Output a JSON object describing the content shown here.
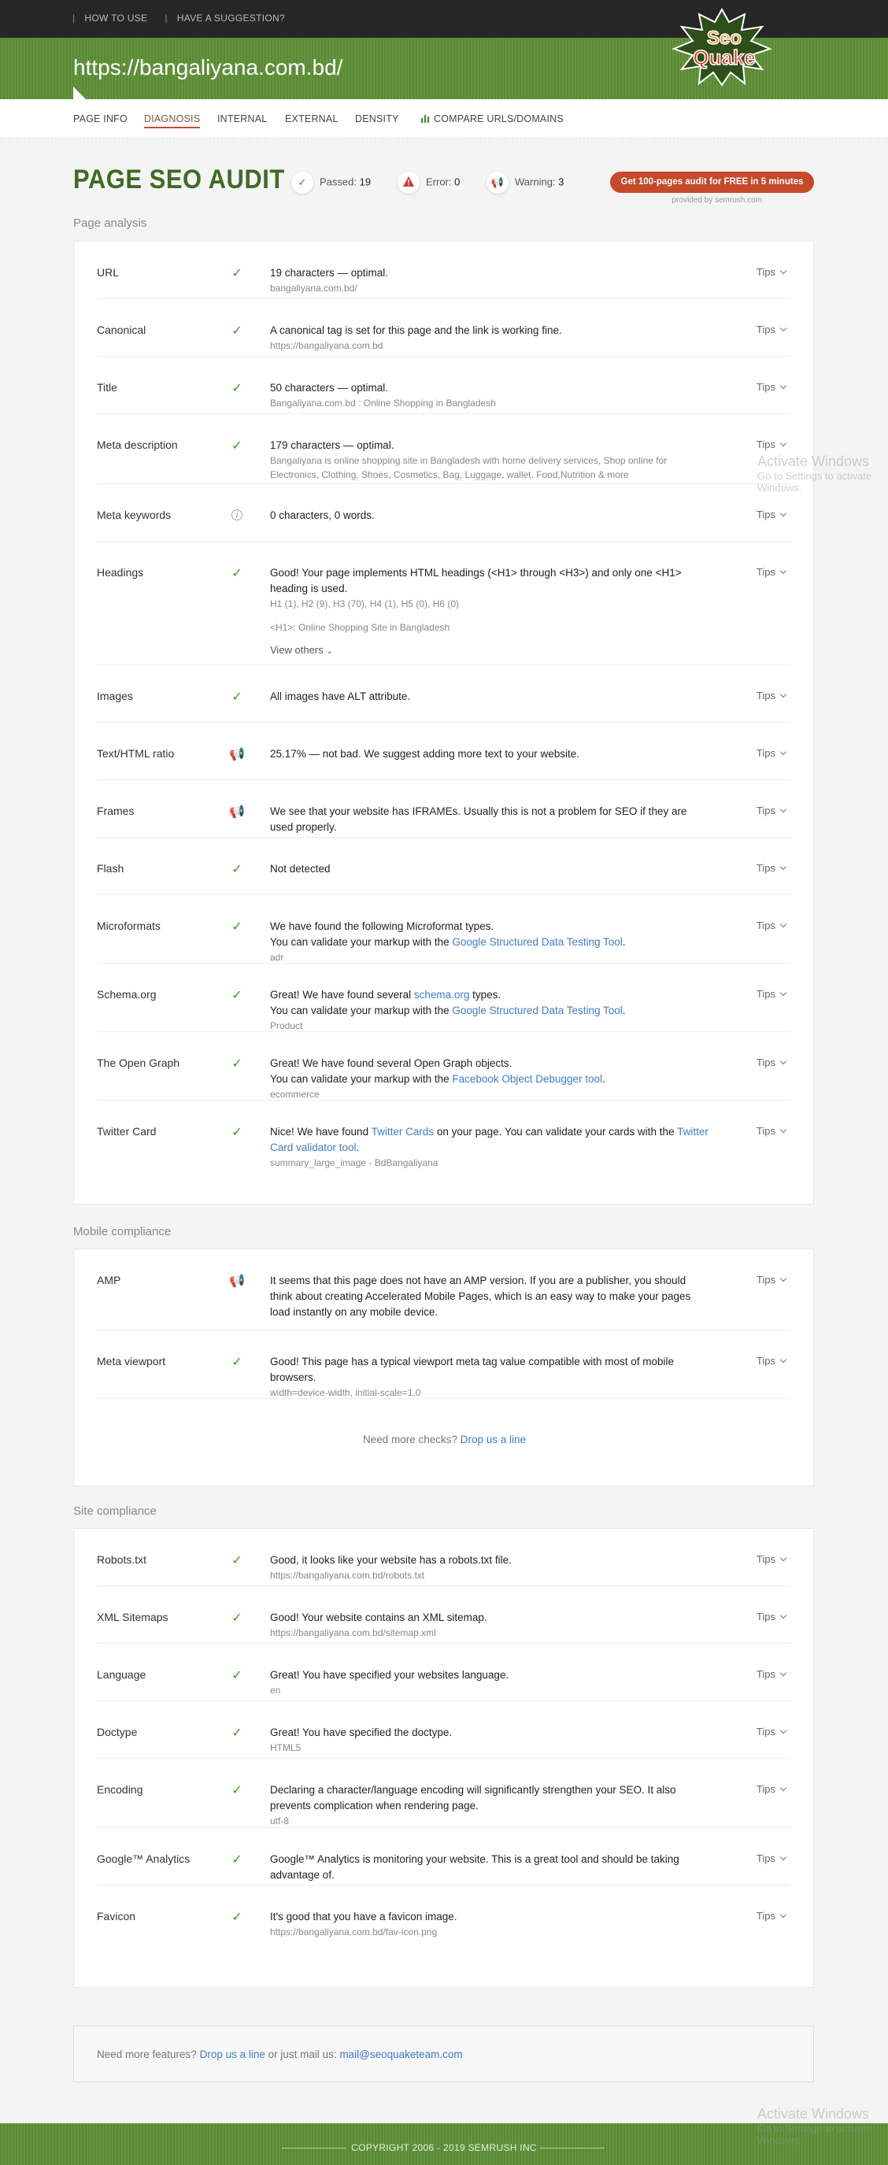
{
  "topbar": {
    "sep": "|",
    "how_to_use": "HOW TO USE",
    "suggestion": "HAVE A SUGGESTION?"
  },
  "url": "https://bangaliyana.com.bd/",
  "logo": {
    "line1": "Seo",
    "line2": "Quake"
  },
  "nav": [
    "PAGE INFO",
    "DIAGNOSIS",
    "INTERNAL",
    "EXTERNAL",
    "DENSITY",
    "COMPARE URLS/DOMAINS"
  ],
  "audit": {
    "title": "PAGE SEO AUDIT",
    "passed_label": "Passed:",
    "passed": "19",
    "error_label": "Error:",
    "error": "0",
    "warning_label": "Warning:",
    "warning": "3",
    "cta": "Get 100-pages audit for FREE in 5 minutes",
    "provided": "provided by  semrush.com"
  },
  "tips": "Tips",
  "page_analysis": {
    "title": "Page analysis",
    "url": {
      "label": "URL",
      "text": "19 characters — optimal.",
      "sub": "bangaliyana.com.bd/"
    },
    "canonical": {
      "label": "Canonical",
      "text": "A canonical tag is set for this page and the link is working fine.",
      "sub": "https://bangaliyana.com.bd"
    },
    "title_row": {
      "label": "Title",
      "text": "50 characters — optimal.",
      "sub": "Bangaliyana.com.bd : Online Shopping in Bangladesh"
    },
    "meta_desc": {
      "label": "Meta description",
      "text": "179 characters — optimal.",
      "sub": "Bangaliyana is online shopping site in Bangladesh with home delivery services, Shop online for Electronics, Clothing, Shoes, Cosmetics, Bag, Luggage, wallet, Food,Nutrition & more"
    },
    "meta_kw": {
      "label": "Meta keywords",
      "text": "0 characters, 0 words."
    },
    "headings": {
      "label": "Headings",
      "text": "Good! Your page implements HTML headings (<H1> through <H3>) and only one <H1> heading is used.",
      "sub": "H1 (1), H2 (9), H3 (70), H4 (1), H5 (0), H6 (0)",
      "sub2": "<H1>: Online Shopping Site in Bangladesh",
      "view_others": "View others"
    },
    "images": {
      "label": "Images",
      "text": "All images have ALT attribute."
    },
    "ratio": {
      "label": "Text/HTML ratio",
      "text": "25.17% — not bad. We suggest adding more text to your website."
    },
    "frames": {
      "label": "Frames",
      "text": "We see that your website has IFRAMEs. Usually this is not a problem for SEO if they are used properly."
    },
    "flash": {
      "label": "Flash",
      "text": "Not detected"
    },
    "micro": {
      "label": "Microformats",
      "text1": "We have found the following Microformat types.",
      "text2a": "You can validate your markup with the ",
      "text2link": "Google Structured Data Testing Tool",
      "text2b": ".",
      "sub": "adr"
    },
    "schema": {
      "label": "Schema.org",
      "text1a": "Great! We have found several ",
      "text1link": "schema.org",
      "text1b": " types.",
      "text2a": "You can validate your markup with the ",
      "text2link": "Google Structured Data Testing Tool",
      "text2b": ".",
      "sub": "Product"
    },
    "og": {
      "label": "The Open Graph",
      "text1": "Great! We have found several Open Graph objects.",
      "text2a": "You can validate your markup with the ",
      "text2link": "Facebook Object Debugger tool",
      "text2b": ".",
      "sub": "ecommerce"
    },
    "twitter": {
      "label": "Twitter Card",
      "text1a": "Nice! We have found ",
      "text1link": "Twitter Cards",
      "text1b": " on your page. You can validate your cards with the ",
      "text2link": "Twitter Card validator tool",
      "text2b": ".",
      "sub": "summary_large_image - BdBangaliyana"
    }
  },
  "mobile": {
    "title": "Mobile compliance",
    "amp": {
      "label": "AMP",
      "text": "It seems that this page does not have an AMP version. If you are a publisher, you should think about creating Accelerated Mobile Pages, which is an easy way to make your pages load instantly on any mobile device."
    },
    "viewport": {
      "label": "Meta viewport",
      "text": "Good! This page has a typical viewport meta tag value compatible with most of mobile browsers.",
      "sub": "width=device-width, initial-scale=1.0"
    },
    "more": "Need more checks?",
    "more_link": "Drop us a line"
  },
  "site": {
    "title": "Site compliance",
    "robots": {
      "label": "Robots.txt",
      "text": "Good, it looks like your website has a robots.txt file.",
      "sub": "https://bangaliyana.com.bd/robots.txt"
    },
    "sitemap": {
      "label": "XML Sitemaps",
      "text": "Good! Your website contains an XML sitemap.",
      "sub": "https://bangaliyana.com.bd/sitemap.xml"
    },
    "language": {
      "label": "Language",
      "text": "Great! You have specified your websites language.",
      "sub": "en"
    },
    "doctype": {
      "label": "Doctype",
      "text": "Great! You have specified the doctype.",
      "sub": "HTML5"
    },
    "encoding": {
      "label": "Encoding",
      "text": "Declaring a character/language encoding will significantly strengthen your SEO. It also prevents complication when rendering page.",
      "sub": "utf-8"
    },
    "analytics": {
      "label": "Google™ Analytics",
      "text": "Google™ Analytics is monitoring your website. This is a great tool and should be taking advantage of."
    },
    "favicon": {
      "label": "Favicon",
      "text": "It's good that you have a favicon image.",
      "sub": "https://bangaliyana.com.bd/fav-icon.png"
    }
  },
  "footer": {
    "text1": "Need more features? ",
    "link1": "Drop us a line",
    "text2": " or just mail us: ",
    "link2": "mail@seoquaketeam.com"
  },
  "copyright": "COPYRIGHT 2006 - 2019 SEMRUSH INC",
  "watermark": {
    "title": "Activate Windows",
    "sub": "Go to Settings to activate Windows."
  }
}
